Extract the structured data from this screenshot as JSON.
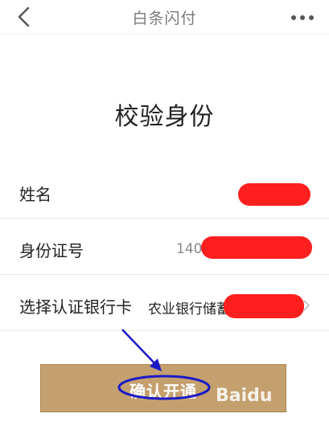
{
  "navbar": {
    "title": "白条闪付",
    "back_icon": "chevron-left-icon",
    "more_icon": "more-horizontal-icon"
  },
  "heading": "校验身份",
  "form": {
    "rows": [
      {
        "label": "姓名",
        "value": ""
      },
      {
        "label": "身份证号",
        "value": "140"
      },
      {
        "label": "选择认证银行卡",
        "value": "农业银行储蓄"
      }
    ]
  },
  "submit": {
    "label": "确认开通"
  },
  "colors": {
    "button_bg": "#c4a06e",
    "redaction": "#ff1f1f",
    "annotation": "#1a1ac8"
  },
  "watermark": "Baidu"
}
